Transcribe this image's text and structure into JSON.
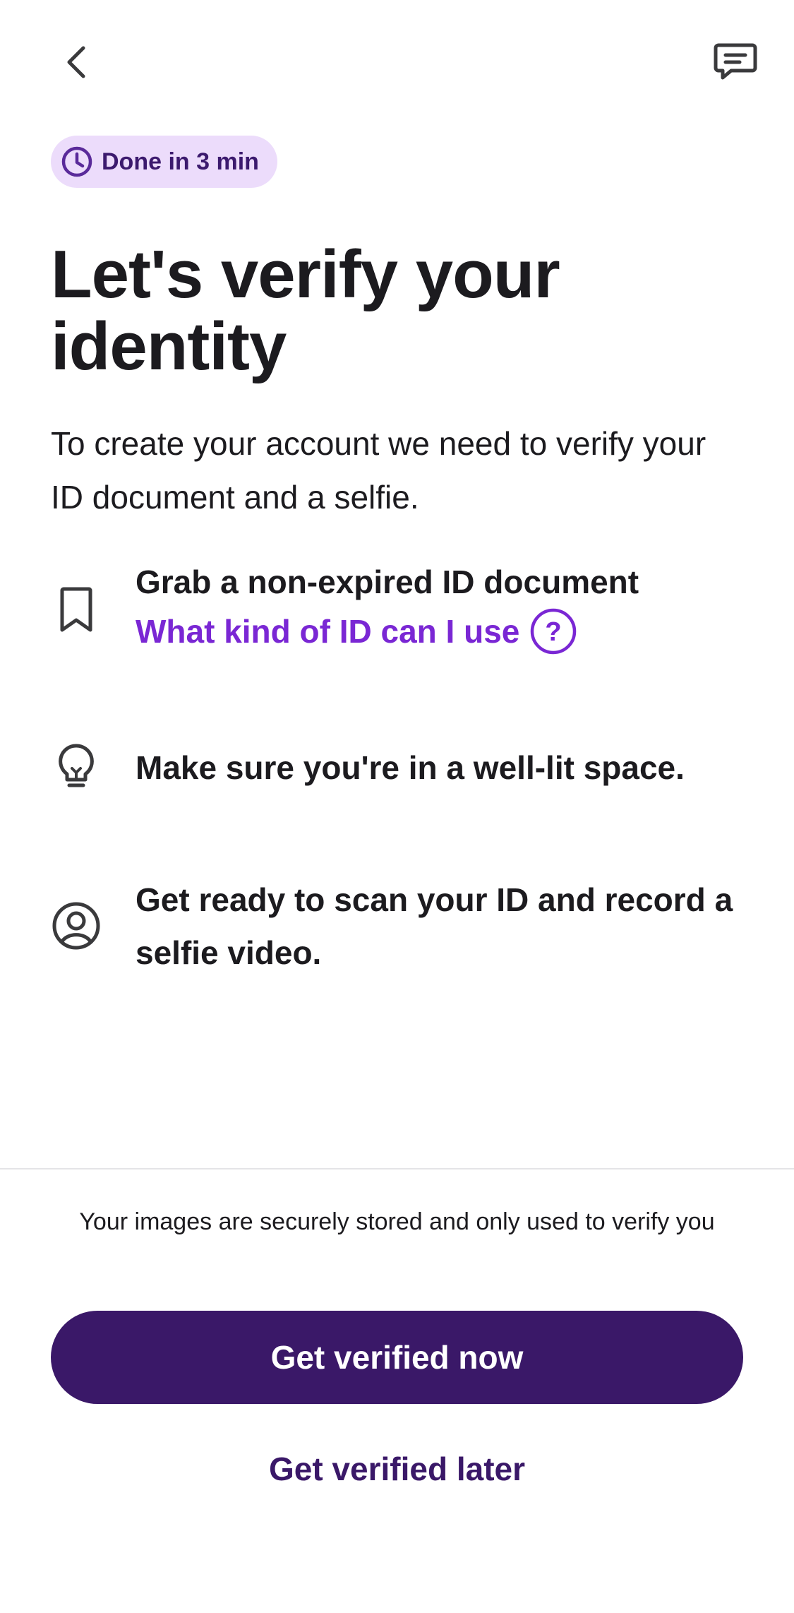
{
  "header": {
    "back_icon": "chevron-left-icon",
    "chat_icon": "chat-bubble-icon"
  },
  "badge": {
    "icon": "clock-icon",
    "label": "Done in 3 min",
    "background": "#ecdcfb",
    "color": "#3c1a6e"
  },
  "main": {
    "title_line1": "Let's verify your",
    "title_line2": "identity",
    "subtitle": "To create your account we need to verify your ID document and a selfie."
  },
  "steps": [
    {
      "icon": "bookmark-icon",
      "text": "Grab a non-expired ID document",
      "link": {
        "label": "What kind of ID can I use",
        "icon": "question-circle-icon",
        "color": "#7a27d4"
      }
    },
    {
      "icon": "lightbulb-icon",
      "text": "Make sure you're in a well-lit space."
    },
    {
      "icon": "user-circle-icon",
      "text": "Get ready to scan your ID and record a selfie video."
    }
  ],
  "footer": {
    "secure_note": "Your images are securely stored and only used to verify you",
    "primary_label": "Get verified now",
    "secondary_label": "Get verified later",
    "primary_color": "#3a1868"
  }
}
